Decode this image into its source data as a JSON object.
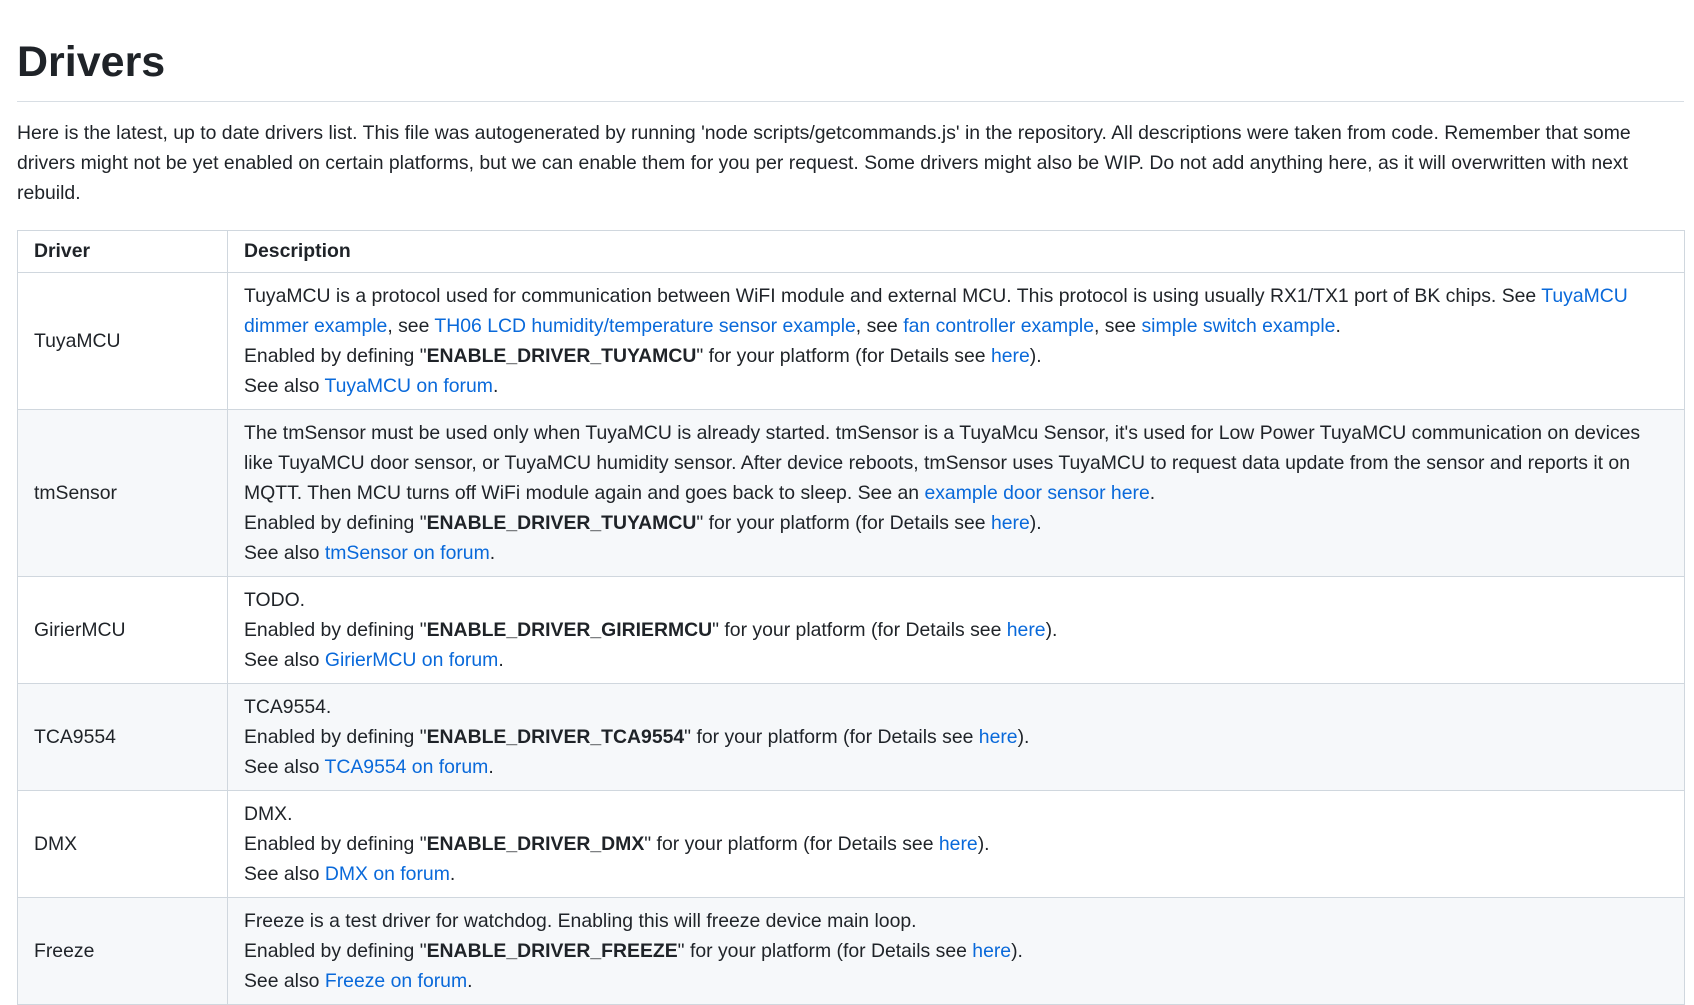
{
  "title": "Drivers",
  "intro": "Here is the latest, up to date drivers list. This file was autogenerated by running 'node scripts/getcommands.js' in the repository. All descriptions were taken from code. Remember that some drivers might not be yet enabled on certain platforms, but we can enable them for you per request. Some drivers might also be WIP. Do not add anything here, as it will overwritten with next rebuild.",
  "table": {
    "headers": [
      "Driver",
      "Description"
    ],
    "enabled_prefix": "Enabled by defining \"",
    "enabled_suffix": "\" for your platform (for Details see ",
    "here_link": "here",
    "close": ").",
    "see_also": "See also ",
    "period": ".",
    "rows": [
      {
        "name": "TuyaMCU",
        "desc_text": "TuyaMCU is a protocol used for communication between WiFI module and external MCU. This protocol is using usually RX1/TX1 port of BK chips. See ",
        "links": [
          "TuyaMCU dimmer example",
          "TH06 LCD humidity/temperature sensor example",
          "fan controller example",
          "simple switch example"
        ],
        "sep": ", see ",
        "define": "ENABLE_DRIVER_TUYAMCU",
        "forum": "TuyaMCU on forum"
      },
      {
        "name": "tmSensor",
        "desc_text": "The tmSensor must be used only when TuyaMCU is already started. tmSensor is a TuyaMcu Sensor, it's used for Low Power TuyaMCU communication on devices like TuyaMCU door sensor, or TuyaMCU humidity sensor. After device reboots, tmSensor uses TuyaMCU to request data update from the sensor and reports it on MQTT. Then MCU turns off WiFi module again and goes back to sleep. See an ",
        "link": "example door sensor here",
        "define": "ENABLE_DRIVER_TUYAMCU",
        "forum": "tmSensor on forum"
      },
      {
        "name": "GirierMCU",
        "desc_text": "TODO.",
        "define": "ENABLE_DRIVER_GIRIERMCU",
        "forum": "GirierMCU on forum"
      },
      {
        "name": "TCA9554",
        "desc_text": "TCA9554.",
        "define": "ENABLE_DRIVER_TCA9554",
        "forum": "TCA9554 on forum"
      },
      {
        "name": "DMX",
        "desc_text": "DMX.",
        "define": "ENABLE_DRIVER_DMX",
        "forum": "DMX on forum"
      },
      {
        "name": "Freeze",
        "desc_text": "Freeze is a test driver for watchdog. Enabling this will freeze device main loop.",
        "define": "ENABLE_DRIVER_FREEZE",
        "forum": "Freeze on forum"
      }
    ]
  }
}
